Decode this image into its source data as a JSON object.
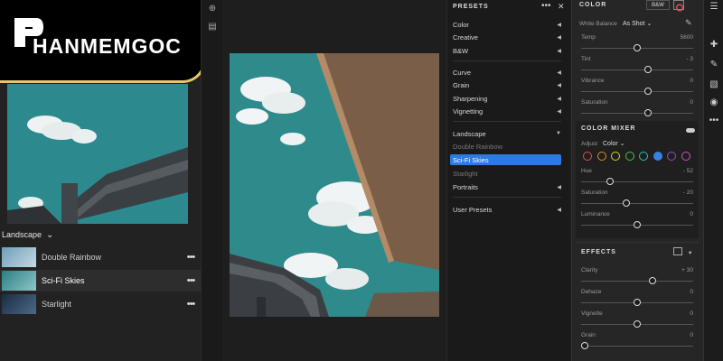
{
  "logo": {
    "text": "HANMEMGOC"
  },
  "left_panel": {
    "group_label": "Landscape",
    "items": [
      {
        "label": "Double Rainbow",
        "more": "•••"
      },
      {
        "label": "Sci-Fi Skies",
        "more": "•••"
      },
      {
        "label": "Starlight",
        "more": "•••"
      }
    ]
  },
  "presets": {
    "title": "PRESETS",
    "more": "•••",
    "close": "✕",
    "groups": [
      {
        "label": "Color"
      },
      {
        "label": "Creative"
      },
      {
        "label": "B&W"
      },
      {
        "label": "Curve"
      },
      {
        "label": "Grain"
      },
      {
        "label": "Sharpening"
      },
      {
        "label": "Vignetting"
      },
      {
        "label": "Landscape"
      },
      {
        "label": "Double Rainbow"
      },
      {
        "label": "Sci-Fi Skies"
      },
      {
        "label": "Starlight"
      },
      {
        "label": "Portraits"
      },
      {
        "label": "User Presets"
      }
    ]
  },
  "edit": {
    "color": {
      "title": "COLOR",
      "bw_label": "B&W",
      "white_balance_label": "White Balance",
      "white_balance_value": "As Shot",
      "sliders": [
        {
          "label": "Temp",
          "value": "5600",
          "pos": 0.5
        },
        {
          "label": "Tint",
          "value": "- 3",
          "pos": 0.6
        },
        {
          "label": "Vibrance",
          "value": "0",
          "pos": 0.6
        },
        {
          "label": "Saturation",
          "value": "0",
          "pos": 0.6
        }
      ]
    },
    "color_mixer": {
      "title": "COLOR MIXER",
      "adjust_label": "Adjust",
      "adjust_value": "Color",
      "swatches": [
        "#e05050",
        "#e09030",
        "#e0d030",
        "#50c050",
        "#30c0c0",
        "#3a80e0",
        "#8a50d0",
        "#d050c0"
      ],
      "sliders": [
        {
          "label": "Hue",
          "value": "- 52",
          "pos": 0.24
        },
        {
          "label": "Saturation",
          "value": "- 20",
          "pos": 0.4
        },
        {
          "label": "Luminance",
          "value": "0",
          "pos": 0.5
        }
      ]
    },
    "effects": {
      "title": "EFFECTS",
      "sliders": [
        {
          "label": "Clarity",
          "value": "+ 30",
          "pos": 0.65
        },
        {
          "label": "Dehaze",
          "value": "0",
          "pos": 0.5
        },
        {
          "label": "Vignette",
          "value": "0",
          "pos": 0.5
        },
        {
          "label": "Grain",
          "value": "0",
          "pos": 0.0
        }
      ]
    }
  },
  "colors": {
    "accent": "#2d7ae0",
    "logo_border": "#e8c56a",
    "sky": "#2f8a8c"
  }
}
